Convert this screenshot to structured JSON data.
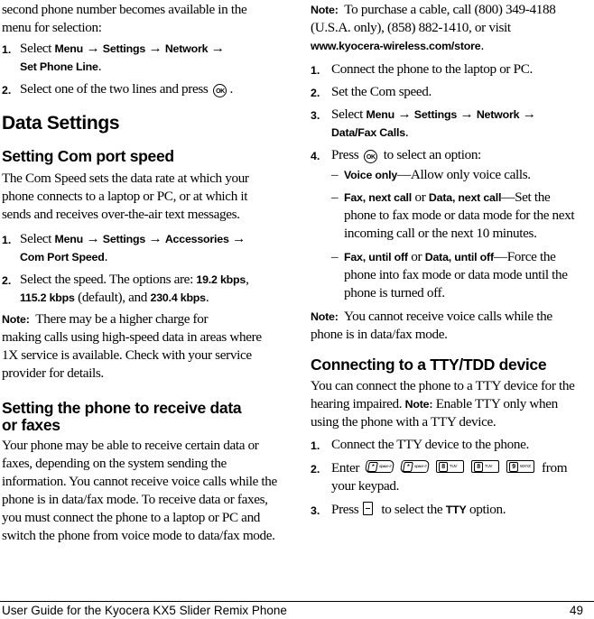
{
  "left_column": {
    "intro_lines": [
      "second phone number becomes available in the",
      "menu for selection:"
    ],
    "steps_phone_line": [
      {
        "num": "1.",
        "prefix": "Select ",
        "path": [
          "Menu",
          "Settings",
          "Network"
        ],
        "path_cont": "Set Phone Line",
        "suffix": "."
      },
      {
        "num": "2.",
        "text": "Select one of the two lines and press",
        "icon": "OK",
        "suffix": "."
      }
    ],
    "section_title": "Data Settings",
    "com_port": {
      "heading": "Setting Com port speed",
      "body_lines": [
        "The Com Speed sets the data rate at which your",
        "phone connects to a laptop or PC, or at which it",
        "sends and receives over-the-air text messages."
      ],
      "steps": [
        {
          "num": "1.",
          "prefix": "Select ",
          "path": [
            "Menu",
            "Settings",
            "Accessories"
          ],
          "path_cont": "Com Port Speed",
          "suffix": "."
        },
        {
          "num": "2.",
          "text": "Select the speed. The options are: ",
          "opt1": "19.2 kbps",
          "opt2": "115.2 kbps",
          "default": " (default), and ",
          "opt3": "230.4 kbps",
          "suffix": "."
        }
      ],
      "note_label": "Note:",
      "note_lines": [
        "There may be a higher charge for",
        "making calls using high-speed data in areas where",
        "1X service is available. Check with your service",
        "provider for details."
      ]
    },
    "receive_data": {
      "heading_lines": [
        "Setting the phone to receive data",
        "or faxes"
      ],
      "body_lines": [
        "Your phone may be able to receive certain data or",
        "faxes, depending on the system sending the",
        "information. You cannot receive voice calls while the",
        "phone is in data/fax mode. To receive data or faxes,",
        "you must connect the phone to a laptop or PC and",
        "switch the phone from voice mode to data/fax mode."
      ]
    }
  },
  "right_column": {
    "cable_note": {
      "label": "Note:",
      "line1": "To purchase a cable, call (800) 349-4188",
      "line2": "(U.S.A. only), (858) 882-1410, or visit",
      "url": "www.kyocera-wireless.com/store"
    },
    "steps": [
      {
        "num": "1.",
        "text": "Connect the phone to the laptop or PC."
      },
      {
        "num": "2.",
        "text": "Set the Com speed."
      },
      {
        "num": "3.",
        "prefix": "Select ",
        "path": [
          "Menu",
          "Settings",
          "Network"
        ],
        "path_cont": "Data/Fax Calls",
        "suffix": "."
      },
      {
        "num": "4.",
        "prefix": "Press",
        "icon": "OK",
        "suffix": "to select an option:"
      }
    ],
    "options": [
      {
        "bold": "Voice only",
        "text": "—Allow only voice calls."
      },
      {
        "bold1": "Fax, next call",
        "or": " or ",
        "bold2": "Data, next call",
        "text": "—Set the",
        "lines": [
          "phone to fax mode or data mode for the next",
          "incoming call or the next 10 minutes."
        ]
      },
      {
        "bold1": "Fax, until off",
        "or": " or ",
        "bold2": "Data, until off",
        "text": "—Force the",
        "lines": [
          "phone into fax mode or data mode until the",
          "phone is turned off."
        ]
      }
    ],
    "mode_note": {
      "label": "Note:",
      "lines": [
        "You cannot receive voice calls while the",
        "phone is in data/fax mode."
      ]
    },
    "tty": {
      "heading": "Connecting to a TTY/TDD device",
      "body_line1": "You can connect the phone to a TTY device for the",
      "body_line2_pre": "hearing impaired. ",
      "body_note_label": "Note:",
      "body_line2_post": " Enable TTY only when",
      "body_line3": "using the phone with a TTY device.",
      "steps": [
        {
          "num": "1.",
          "text": "Connect the TTY device to the phone."
        },
        {
          "num": "2.",
          "prefix": "Enter",
          "keys": [
            {
              "key": "*",
              "sub": "space #",
              "shape": "slant"
            },
            {
              "key": "*",
              "sub": "space #",
              "shape": "slant"
            },
            {
              "key": "8",
              "sub": "TUV",
              "shape": "rect"
            },
            {
              "key": "8",
              "sub": "TUV",
              "shape": "rect"
            },
            {
              "key": "9",
              "sub": "WXYZ",
              "shape": "rect"
            }
          ],
          "suffix": "from",
          "cont": "your keypad."
        },
        {
          "num": "3.",
          "prefix": "Press",
          "icon": "left-softkey",
          "mid": "to select the ",
          "bold": "TTY",
          "suffix": " option."
        }
      ]
    }
  },
  "footer": {
    "title": "User Guide for the Kyocera KX5 Slider Remix Phone",
    "page_number": "49"
  },
  "symbols": {
    "arrow": "→",
    "dash": "–"
  }
}
